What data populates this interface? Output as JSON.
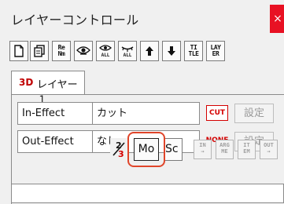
{
  "window": {
    "title": "レイヤーコントロール",
    "close_label": "×"
  },
  "toolbar": {
    "buttons": [
      {
        "name": "new-icon",
        "label": ""
      },
      {
        "name": "copy-icon",
        "label": ""
      },
      {
        "name": "rename-button",
        "label": "Re\nNm"
      },
      {
        "name": "eye-icon",
        "label": ""
      },
      {
        "name": "show-all-icon",
        "label": ""
      },
      {
        "name": "hide-all-icon",
        "label": ""
      },
      {
        "name": "move-up-icon",
        "label": ""
      },
      {
        "name": "move-down-icon",
        "label": ""
      },
      {
        "name": "title-button",
        "label": "TI\nTLE"
      },
      {
        "name": "layer-button",
        "label": "LAY\nER"
      }
    ]
  },
  "tab": {
    "badge": "3D",
    "label": "レイヤー１"
  },
  "effects": [
    {
      "label": "In-Effect",
      "value": "カット",
      "badge": "CUT",
      "button": "設定"
    },
    {
      "label": "Out-Effect",
      "value": "なし",
      "badge": "NONE",
      "button": "設定"
    }
  ],
  "bottom": {
    "mo_label": "Mo",
    "sc_label": "Sc",
    "arrow_buttons": [
      "IN\n→",
      "ARG\nME",
      "IT\nEM",
      "OUT\n→"
    ]
  },
  "colors": {
    "accent_red": "#d40000",
    "highlight": "#e0452a",
    "close_bg": "#e81123"
  }
}
